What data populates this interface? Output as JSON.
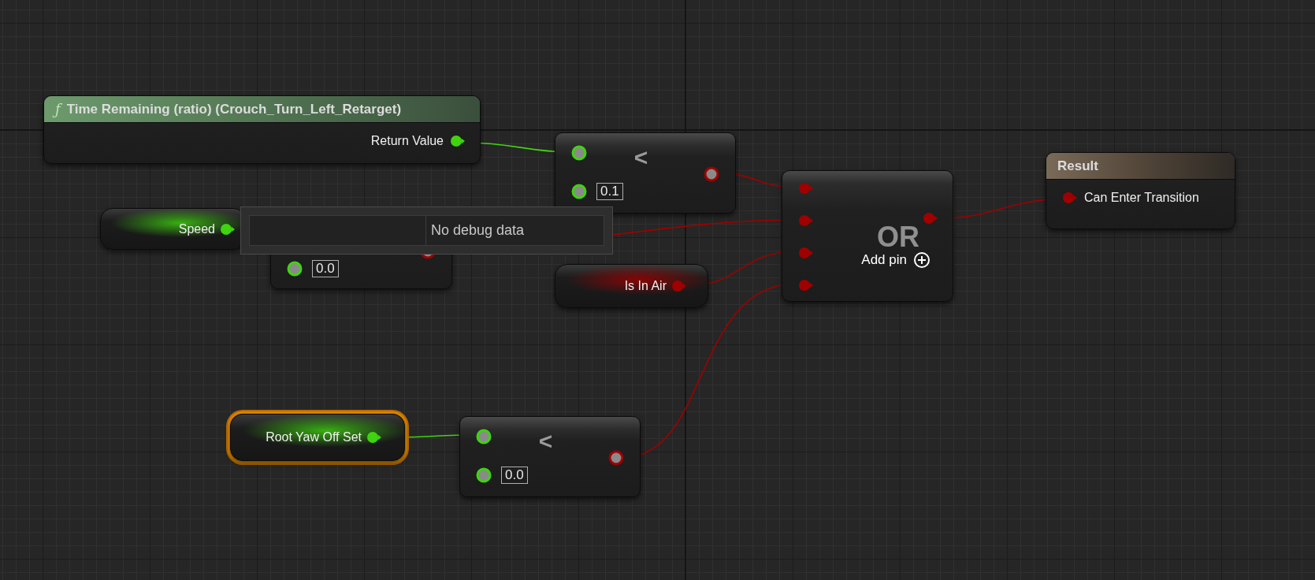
{
  "graph": {
    "nodes": [
      {
        "kind": "function",
        "glyph": "ƒ",
        "title": "Time Remaining (ratio) (Crouch_Turn_Left_Retarget)",
        "output": "Return Value",
        "selected": false
      },
      {
        "kind": "compare",
        "operator": "<",
        "value": "0.1",
        "selected": false
      },
      {
        "kind": "variable",
        "label": "Speed",
        "color": "#3fd40f",
        "selected": false
      },
      {
        "kind": "compare",
        "value": "0.0",
        "selected": false
      },
      {
        "kind": "variable",
        "label": "Is In Air",
        "color": "#a00000",
        "selected": false
      },
      {
        "kind": "or",
        "title": "OR",
        "add_pin": "Add pin",
        "selected": false
      },
      {
        "kind": "result",
        "title": "Result",
        "input": "Can Enter Transition",
        "selected": false
      },
      {
        "kind": "variable",
        "label": "Root Yaw Off Set",
        "color": "#3fd40f",
        "selected": true
      },
      {
        "kind": "compare",
        "operator": "<",
        "value": "0.0",
        "selected": false
      }
    ]
  },
  "tooltip": {
    "text": "No debug data"
  }
}
